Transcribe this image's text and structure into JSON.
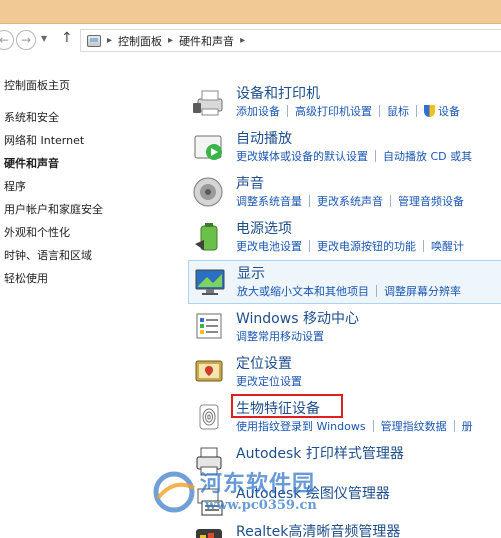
{
  "address": {
    "crumbs": [
      "控制面板",
      "硬件和声音"
    ]
  },
  "sidebar": {
    "items": [
      {
        "label": "控制面板主页"
      },
      {
        "label": "系统和安全"
      },
      {
        "label": "网络和 Internet"
      },
      {
        "label": "硬件和声音"
      },
      {
        "label": "程序"
      },
      {
        "label": "用户帐户和家庭安全"
      },
      {
        "label": "外观和个性化"
      },
      {
        "label": "时钟、语言和区域"
      },
      {
        "label": "轻松使用"
      }
    ]
  },
  "categories": [
    {
      "title": "设备和打印机",
      "links": [
        "添加设备",
        "高级打印机设置",
        "鼠标",
        "设备"
      ],
      "icon": "printer-icon"
    },
    {
      "title": "自动播放",
      "links": [
        "更改媒体或设备的默认设置",
        "自动播放 CD 或其"
      ],
      "icon": "autoplay-icon"
    },
    {
      "title": "声音",
      "links": [
        "调整系统音量",
        "更改系统声音",
        "管理音频设备"
      ],
      "icon": "speaker-icon"
    },
    {
      "title": "电源选项",
      "links": [
        "更改电池设置",
        "更改电源按钮的功能",
        "唤醒计"
      ],
      "icon": "battery-icon"
    },
    {
      "title": "显示",
      "links": [
        "放大或缩小文本和其他项目",
        "调整屏幕分辨率"
      ],
      "icon": "monitor-icon"
    },
    {
      "title": "Windows 移动中心",
      "links": [
        "调整常用移动设置"
      ],
      "icon": "mobility-center-icon"
    },
    {
      "title": "定位设置",
      "links": [
        "更改定位设置"
      ],
      "icon": "location-icon"
    },
    {
      "title": "生物特征设备",
      "links": [
        "使用指纹登录到 Windows",
        "管理指纹数据",
        "册"
      ],
      "icon": "fingerprint-icon"
    },
    {
      "title": "Autodesk 打印样式管理器",
      "links": [],
      "icon": "printer-style-icon"
    },
    {
      "title": "Autodesk 绘图仪管理器",
      "links": [],
      "icon": "plotter-icon"
    },
    {
      "title": "Realtek高清晰音频管理器",
      "links": [],
      "icon": "realtek-icon"
    }
  ],
  "watermark": {
    "title": "河东软件园",
    "url": "www.pc0359.cn"
  },
  "colors": {
    "titlebar": "#f1c994",
    "link": "#1a57b3",
    "heading": "#1e4e8c",
    "highlight_bg": "#eef6fc",
    "red_box": "#e02020"
  }
}
